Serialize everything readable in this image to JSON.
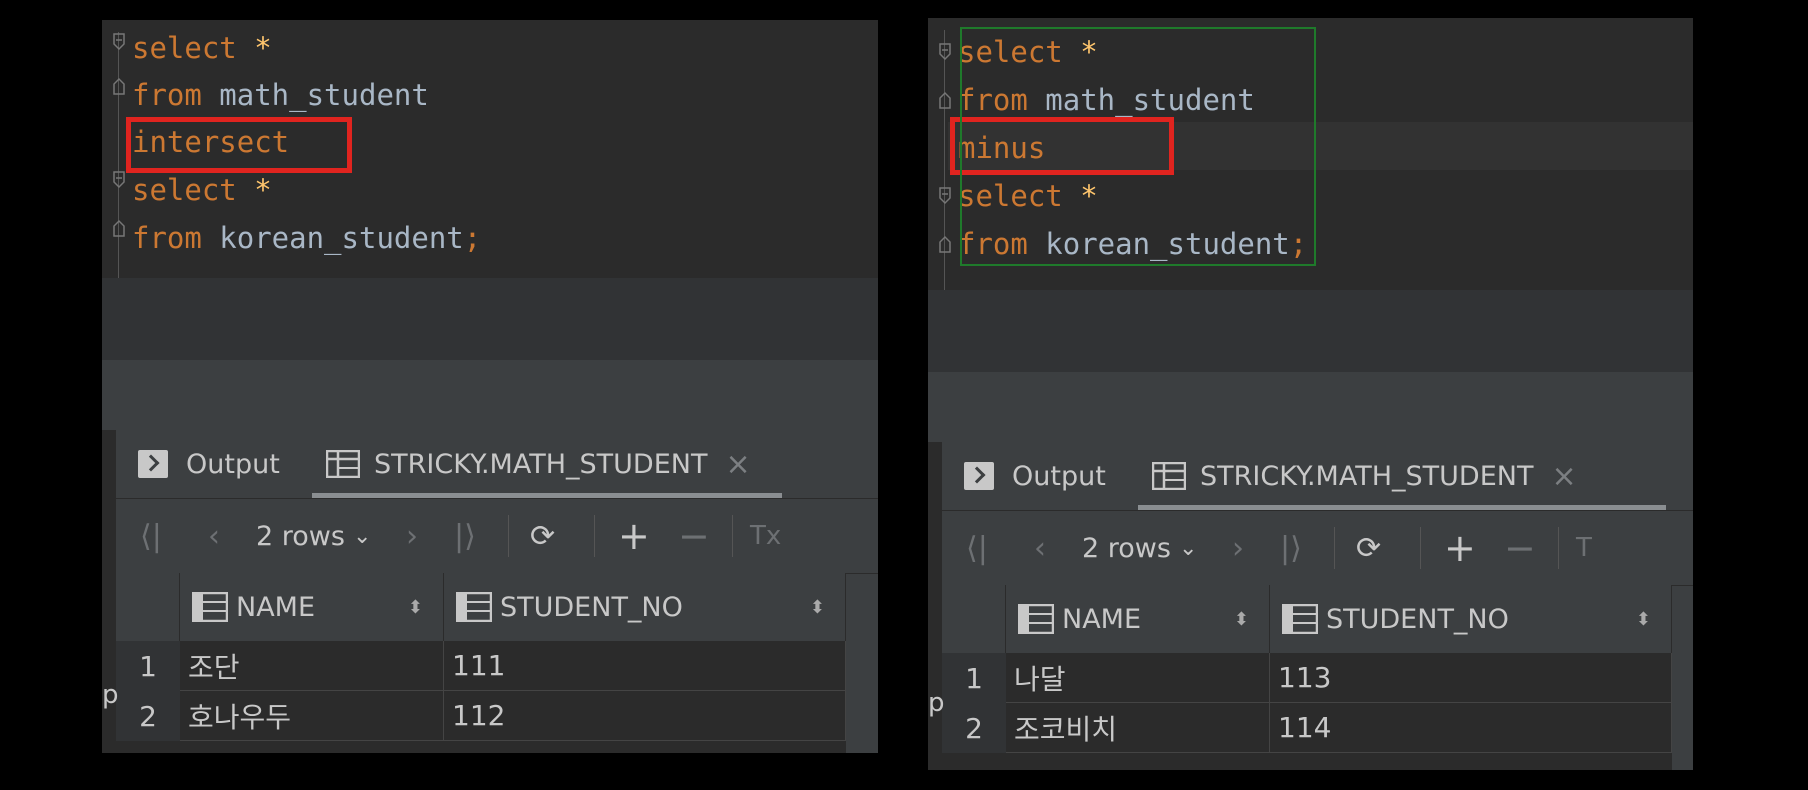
{
  "left": {
    "code": [
      {
        "kw": "select",
        "rest": " *"
      },
      {
        "kw": "from",
        "rest": " math_student"
      },
      {
        "kw": "intersect",
        "rest": ""
      },
      {
        "kw": "select",
        "rest": " *"
      },
      {
        "kw": "from",
        "rest": " korean_student",
        "semi": ";"
      }
    ],
    "tabs": {
      "output": "Output",
      "result": "STRICKY.MATH_STUDENT",
      "close": "×"
    },
    "toolbar": {
      "rows": "2 rows",
      "tx": "Tx"
    },
    "columns": [
      "NAME",
      "STUDENT_NO"
    ],
    "rows": [
      {
        "num": "1",
        "name": "조단",
        "no": "111"
      },
      {
        "num": "2",
        "name": "호나우두",
        "no": "112"
      }
    ],
    "edge_char": "p"
  },
  "right": {
    "code": [
      {
        "kw": "select",
        "rest": " *"
      },
      {
        "kw": "from",
        "rest": " math_student"
      },
      {
        "kw": "minus",
        "rest": ""
      },
      {
        "kw": "select",
        "rest": " *"
      },
      {
        "kw": "from",
        "rest": " korean_student",
        "semi": ";"
      }
    ],
    "tabs": {
      "output": "Output",
      "result": "STRICKY.MATH_STUDENT",
      "close": "×"
    },
    "toolbar": {
      "rows": "2 rows",
      "tx": "T"
    },
    "columns": [
      "NAME",
      "STUDENT_NO"
    ],
    "rows": [
      {
        "num": "1",
        "name": "나달",
        "no": "113"
      },
      {
        "num": "2",
        "name": "조코비치",
        "no": "114"
      }
    ],
    "edge_char": "p"
  },
  "icons": {
    "first": "⟨|",
    "prev": "‹",
    "next": "›",
    "last": "|⟩",
    "refresh": "⟳",
    "add": "+",
    "remove": "−",
    "dropdown": "⌄",
    "sort": "⬍"
  },
  "colors": {
    "highlight": "#e0241f",
    "keyword": "#cc7832",
    "star": "#ffc66d",
    "ident": "#a9b7c6",
    "selection": "#1f7a2b"
  }
}
